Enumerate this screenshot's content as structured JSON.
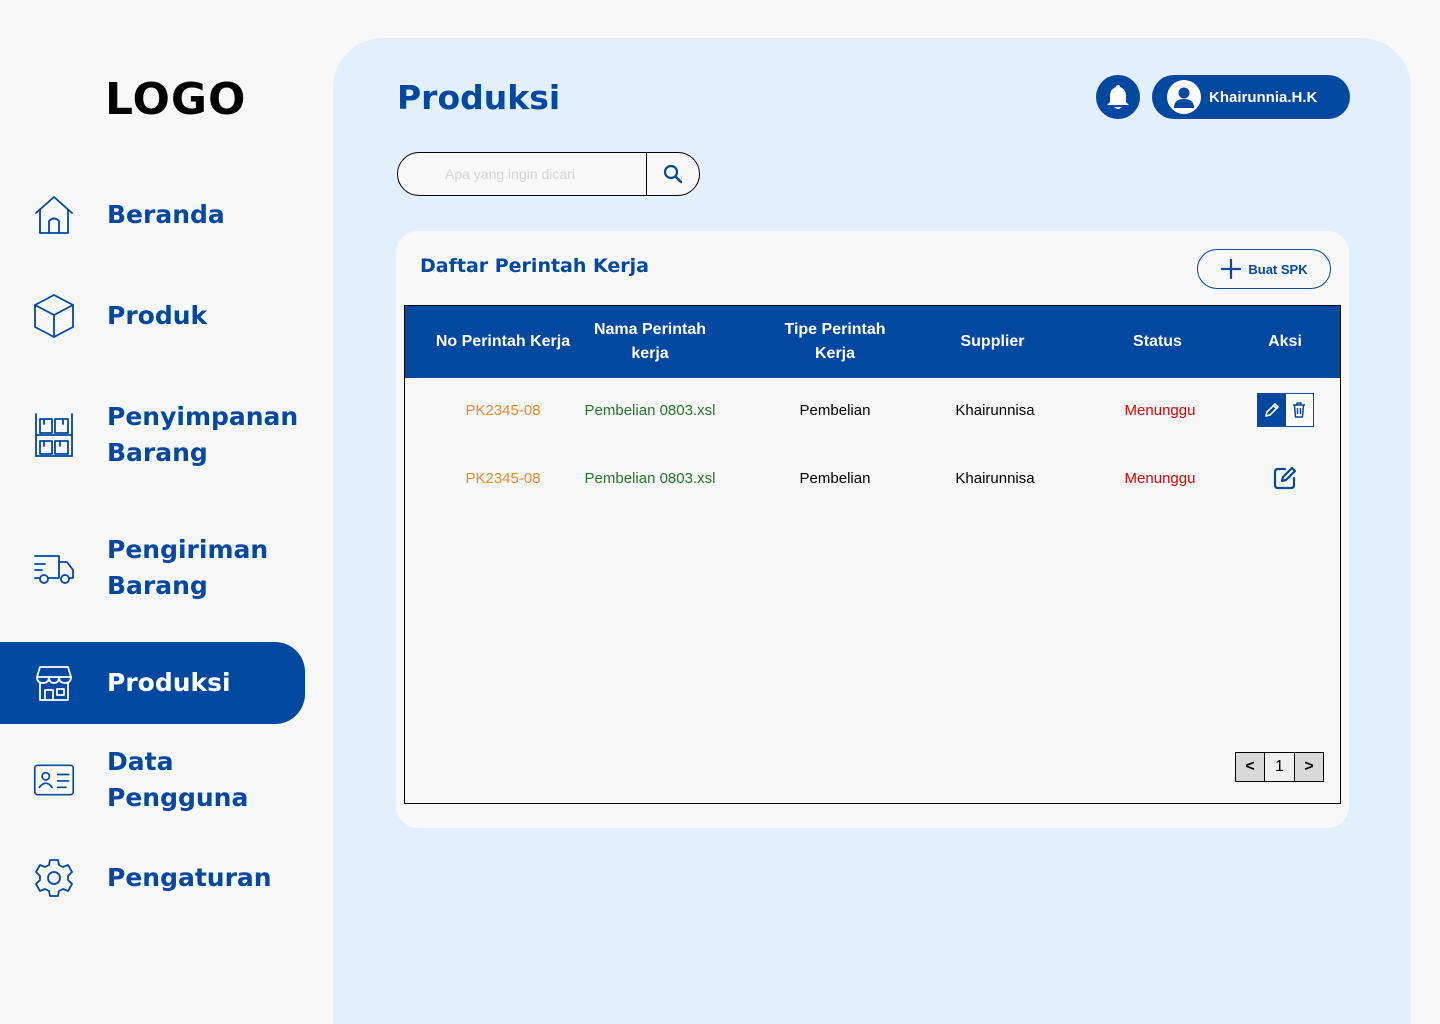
{
  "logo": "LOGO",
  "sidebar": {
    "items": [
      {
        "label": "Beranda",
        "icon": "home-icon"
      },
      {
        "label": "Produk",
        "icon": "box-icon"
      },
      {
        "label": "Penyimpanan Barang",
        "icon": "warehouse-shelf-icon"
      },
      {
        "label": "Pengiriman Barang",
        "icon": "delivery-truck-icon"
      },
      {
        "label": "Produksi",
        "icon": "store-icon",
        "active": true
      },
      {
        "label": "Data Pengguna",
        "icon": "id-card-icon"
      },
      {
        "label": "Pengaturan",
        "icon": "gear-icon"
      }
    ]
  },
  "header": {
    "title": "Produksi",
    "user_name": "Khairunnia.H.K"
  },
  "search": {
    "placeholder": "Apa yang ingin dicari",
    "value": ""
  },
  "card": {
    "title": "Daftar Perintah Kerja",
    "new_button_label": "Buat SPK",
    "columns": [
      "No Perintah Kerja",
      "Nama Perintah kerja",
      "Tipe Perintah Kerja",
      "Supplier",
      "Status",
      "Aksi"
    ],
    "rows": [
      {
        "no": "PK2345-08",
        "name": "Pembelian 0803.xsl",
        "type": "Pembelian",
        "supplier": "Khairunnisa",
        "status": "Menunggu",
        "actions": [
          "pencil-icon",
          "trash-icon"
        ]
      },
      {
        "no": "PK2345-08",
        "name": "Pembelian 0803.xsl",
        "type": "Pembelian",
        "supplier": "Khairunnisa",
        "status": "Menunggu",
        "actions": [
          "edit-square-icon"
        ]
      }
    ],
    "pagination": {
      "prev": "<",
      "page": "1",
      "next": ">"
    }
  },
  "colors": {
    "primary": "#0148A0",
    "panel": "#E3EFFB",
    "order_no": "#E98A2E",
    "order_name": "#237A2B",
    "status_waiting": "#E00000"
  }
}
